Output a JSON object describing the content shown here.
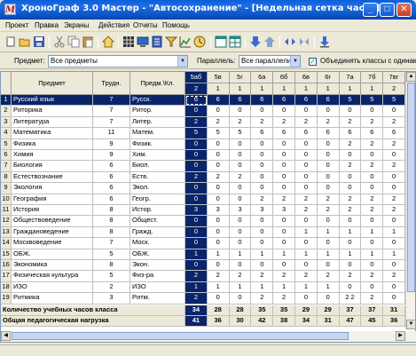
{
  "window": {
    "title": "ХроноГраф 3.0 Мастер - \"Автосохранение\" - [Недельная сетка часов]",
    "app_icon_letter": "M"
  },
  "menu": [
    "Проект",
    "Правка",
    "Экраны",
    "Действия",
    "Отчеты",
    "Помощь"
  ],
  "filter": {
    "subject_label": "Предмет:",
    "subject_value": "Все предметы",
    "parallel_label": "Параллель:",
    "parallel_value": "Все параллели",
    "combine_label": "Объединять классы с одинаковой"
  },
  "grid": {
    "headers": {
      "subject": "Предмет",
      "hours": "Трудн.",
      "short": "Предм.\\Кл."
    },
    "classes": [
      {
        "name": "5аб",
        "groups": "2"
      },
      {
        "name": "5в",
        "groups": "1"
      },
      {
        "name": "5г",
        "groups": "1"
      },
      {
        "name": "6а",
        "groups": "1"
      },
      {
        "name": "6б",
        "groups": "1"
      },
      {
        "name": "6в",
        "groups": "1"
      },
      {
        "name": "6г",
        "groups": "1"
      },
      {
        "name": "7а",
        "groups": "1"
      },
      {
        "name": "7б",
        "groups": "1"
      },
      {
        "name": "7вг",
        "groups": "2"
      }
    ],
    "rows": [
      {
        "n": "1",
        "subject": "Русский язык",
        "hours": "7",
        "short": "Русск.",
        "vals": [
          "6",
          "6",
          "6",
          "6",
          "6",
          "6",
          "6",
          "5",
          "5",
          "5"
        ]
      },
      {
        "n": "2",
        "subject": "Риторика",
        "hours": "7",
        "short": "Ритор.",
        "vals": [
          "0",
          "0",
          "0",
          "0",
          "0",
          "0",
          "0",
          "0",
          "0",
          "0"
        ]
      },
      {
        "n": "3",
        "subject": "Литература",
        "hours": "7",
        "short": "Литер.",
        "vals": [
          "2",
          "2",
          "2",
          "2",
          "2",
          "2",
          "2",
          "2",
          "2",
          "2"
        ]
      },
      {
        "n": "4",
        "subject": "Математика",
        "hours": "11",
        "short": "Матем.",
        "vals": [
          "5",
          "5",
          "5",
          "6",
          "6",
          "6",
          "6",
          "6",
          "6",
          "6"
        ]
      },
      {
        "n": "5",
        "subject": "Физика",
        "hours": "9",
        "short": "Физик.",
        "vals": [
          "0",
          "0",
          "0",
          "0",
          "0",
          "0",
          "0",
          "2",
          "2",
          "2"
        ]
      },
      {
        "n": "6",
        "subject": "Химия",
        "hours": "9",
        "short": "Хим.",
        "vals": [
          "0",
          "0",
          "0",
          "0",
          "0",
          "0",
          "0",
          "0",
          "0",
          "0"
        ]
      },
      {
        "n": "7",
        "subject": "Биология",
        "hours": "6",
        "short": "Биол.",
        "vals": [
          "0",
          "0",
          "0",
          "0",
          "0",
          "0",
          "0",
          "2",
          "2",
          "2"
        ]
      },
      {
        "n": "8",
        "subject": "Естествознание",
        "hours": "6",
        "short": "Еств.",
        "vals": [
          "2",
          "2",
          "2",
          "0",
          "0",
          "0",
          "0",
          "0",
          "0",
          "0"
        ]
      },
      {
        "n": "9",
        "subject": "Экология",
        "hours": "6",
        "short": "Экол.",
        "vals": [
          "0",
          "0",
          "0",
          "0",
          "0",
          "0",
          "0",
          "0",
          "0",
          "0"
        ]
      },
      {
        "n": "10",
        "subject": "География",
        "hours": "6",
        "short": "Геогр.",
        "vals": [
          "0",
          "0",
          "0",
          "2",
          "2",
          "2",
          "2",
          "2",
          "2",
          "2"
        ]
      },
      {
        "n": "11",
        "subject": "История",
        "hours": "8",
        "short": "Истор.",
        "vals": [
          "3",
          "3",
          "3",
          "3",
          "3",
          "2",
          "2",
          "2",
          "2",
          "2"
        ]
      },
      {
        "n": "12",
        "subject": "Обществоведение",
        "hours": "8",
        "short": "Общест.",
        "vals": [
          "0",
          "0",
          "0",
          "0",
          "0",
          "0",
          "0",
          "0",
          "0",
          "0"
        ]
      },
      {
        "n": "13",
        "subject": "Граждановедение",
        "hours": "8",
        "short": "Гражд.",
        "vals": [
          "0",
          "0",
          "0",
          "0",
          "0",
          "1",
          "1",
          "1",
          "1",
          "1"
        ]
      },
      {
        "n": "14",
        "subject": "Москвоведение",
        "hours": "7",
        "short": "Моск.",
        "vals": [
          "0",
          "0",
          "0",
          "0",
          "0",
          "0",
          "0",
          "0",
          "0",
          "0"
        ]
      },
      {
        "n": "15",
        "subject": "ОБЖ.",
        "hours": "5",
        "short": "ОБЖ.",
        "vals": [
          "1",
          "1",
          "1",
          "1",
          "1",
          "1",
          "1",
          "1",
          "1",
          "1"
        ]
      },
      {
        "n": "16",
        "subject": "Экономика",
        "hours": "8",
        "short": "Экон.",
        "vals": [
          "0",
          "0",
          "0",
          "0",
          "0",
          "0",
          "0",
          "0",
          "0",
          "0"
        ]
      },
      {
        "n": "17",
        "subject": "Физическая культура",
        "hours": "5",
        "short": "Физ-ра",
        "vals": [
          "2",
          "2",
          "2",
          "2",
          "2",
          "2",
          "2",
          "2",
          "2",
          "2"
        ]
      },
      {
        "n": "18",
        "subject": "ИЗО",
        "hours": "2",
        "short": "ИЗО",
        "vals": [
          "1",
          "1",
          "1",
          "1",
          "1",
          "1",
          "1",
          "0",
          "0",
          "0"
        ]
      },
      {
        "n": "19",
        "subject": "Ритмика",
        "hours": "3",
        "short": "Ритм.",
        "vals": [
          "2",
          "0",
          "0",
          "2",
          "2",
          "0",
          "0",
          "2 2",
          "2",
          "0"
        ]
      }
    ],
    "totals": [
      {
        "label": "Количество учебных часов класса",
        "vals": [
          "34",
          "28",
          "28",
          "35",
          "35",
          "29",
          "29",
          "37",
          "37",
          "31"
        ]
      },
      {
        "label": "Общая педагогическая нагрузка",
        "vals": [
          "41",
          "36",
          "30",
          "42",
          "38",
          "34",
          "31",
          "47",
          "45",
          "36"
        ]
      }
    ]
  }
}
